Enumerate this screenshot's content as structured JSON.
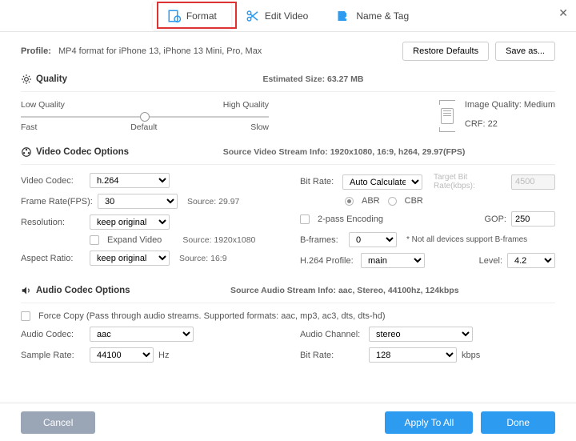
{
  "tabs": {
    "format": "Format",
    "editVideo": "Edit Video",
    "nameTag": "Name & Tag"
  },
  "profile": {
    "label": "Profile:",
    "value": "MP4 format for iPhone 13, iPhone 13 Mini, Pro, Max"
  },
  "buttons": {
    "restoreDefaults": "Restore Defaults",
    "saveAs": "Save as...",
    "cancel": "Cancel",
    "applyToAll": "Apply To All",
    "done": "Done"
  },
  "quality": {
    "title": "Quality",
    "estimatedSize": "Estimated Size: 63.27 MB",
    "low": "Low Quality",
    "high": "High Quality",
    "fast": "Fast",
    "default": "Default",
    "slow": "Slow",
    "imageQuality": "Image Quality: Medium",
    "crf": "CRF: 22"
  },
  "video": {
    "title": "Video Codec Options",
    "sourceInfo": "Source Video Stream Info: 1920x1080, 16:9, h264, 29.97(FPS)",
    "codecLabel": "Video Codec:",
    "codecValue": "h.264",
    "fpsLabel": "Frame Rate(FPS):",
    "fpsValue": "30",
    "fpsSource": "Source: 29.97",
    "resLabel": "Resolution:",
    "resValue": "keep original",
    "resSource": "Source: 1920x1080",
    "expandVideo": "Expand Video",
    "aspectLabel": "Aspect Ratio:",
    "aspectValue": "keep original",
    "aspectSource": "Source: 16:9",
    "bitRateLabel": "Bit Rate:",
    "bitRateValue": "Auto Calculate",
    "targetLabel": "Target Bit Rate(kbps):",
    "targetValue": "4500",
    "abr": "ABR",
    "cbr": "CBR",
    "twopass": "2-pass Encoding",
    "gopLabel": "GOP:",
    "gopValue": "250",
    "bframesLabel": "B-frames:",
    "bframesValue": "0",
    "bframesNote": "* Not all devices support B-frames",
    "profileLabel": "H.264 Profile:",
    "profileValue": "main",
    "levelLabel": "Level:",
    "levelValue": "4.2"
  },
  "audio": {
    "title": "Audio Codec Options",
    "sourceInfo": "Source Audio Stream Info: aac, Stereo, 44100hz, 124kbps",
    "forceCopy": "Force Copy (Pass through audio streams. Supported formats: aac, mp3, ac3, dts, dts-hd)",
    "codecLabel": "Audio Codec:",
    "codecValue": "aac",
    "channelLabel": "Audio Channel:",
    "channelValue": "stereo",
    "sampleLabel": "Sample Rate:",
    "sampleValue": "44100",
    "sampleUnit": "Hz",
    "bitRateLabel": "Bit Rate:",
    "bitRateValue": "128",
    "bitRateUnit": "kbps"
  }
}
